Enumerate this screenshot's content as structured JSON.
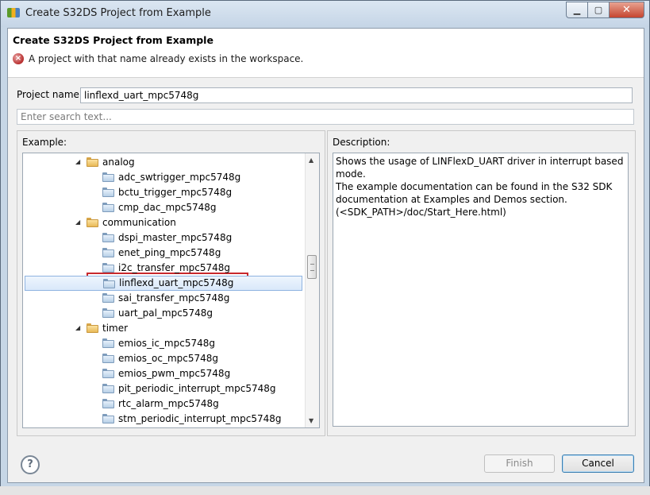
{
  "window": {
    "title": "Create S32DS Project from Example",
    "caption_buttons": [
      "minimize-icon",
      "maximize-icon",
      "close-icon"
    ]
  },
  "header": {
    "title": "Create S32DS Project from Example",
    "error_message": "A project with that name already exists in the workspace."
  },
  "project": {
    "label": "Project name:",
    "value": "linflexd_uart_mpc5748g"
  },
  "search": {
    "placeholder": "Enter search text..."
  },
  "example": {
    "label": "Example:",
    "tree": [
      {
        "label": "analog",
        "level": 0,
        "type": "category",
        "expanded": true
      },
      {
        "label": "adc_swtrigger_mpc5748g",
        "level": 1,
        "type": "project"
      },
      {
        "label": "bctu_trigger_mpc5748g",
        "level": 1,
        "type": "project"
      },
      {
        "label": "cmp_dac_mpc5748g",
        "level": 1,
        "type": "project"
      },
      {
        "label": "communication",
        "level": 0,
        "type": "category",
        "expanded": true
      },
      {
        "label": "dspi_master_mpc5748g",
        "level": 1,
        "type": "project"
      },
      {
        "label": "enet_ping_mpc5748g",
        "level": 1,
        "type": "project"
      },
      {
        "label": "i2c_transfer_mpc5748g",
        "level": 1,
        "type": "project"
      },
      {
        "label": "linflexd_uart_mpc5748g",
        "level": 1,
        "type": "project",
        "selected": true
      },
      {
        "label": "sai_transfer_mpc5748g",
        "level": 1,
        "type": "project"
      },
      {
        "label": "uart_pal_mpc5748g",
        "level": 1,
        "type": "project"
      },
      {
        "label": "timer",
        "level": 0,
        "type": "category",
        "expanded": true
      },
      {
        "label": "emios_ic_mpc5748g",
        "level": 1,
        "type": "project"
      },
      {
        "label": "emios_oc_mpc5748g",
        "level": 1,
        "type": "project"
      },
      {
        "label": "emios_pwm_mpc5748g",
        "level": 1,
        "type": "project"
      },
      {
        "label": "pit_periodic_interrupt_mpc5748g",
        "level": 1,
        "type": "project"
      },
      {
        "label": "rtc_alarm_mpc5748g",
        "level": 1,
        "type": "project"
      },
      {
        "label": "stm_periodic_interrupt_mpc5748g",
        "level": 1,
        "type": "project"
      }
    ]
  },
  "description": {
    "label": "Description:",
    "lines": [
      "Shows the usage of LINFlexD_UART driver in interrupt based mode.",
      "The example documentation can be found in the S32 SDK documentation at Examples and Demos section.",
      "(<SDK_PATH>/doc/Start_Here.html)"
    ]
  },
  "buttons": {
    "help_icon": "help-icon",
    "finish": "Finish",
    "cancel": "Cancel"
  },
  "colors": {
    "selection_outline": "#c8282c",
    "error_icon": "#b83030"
  }
}
